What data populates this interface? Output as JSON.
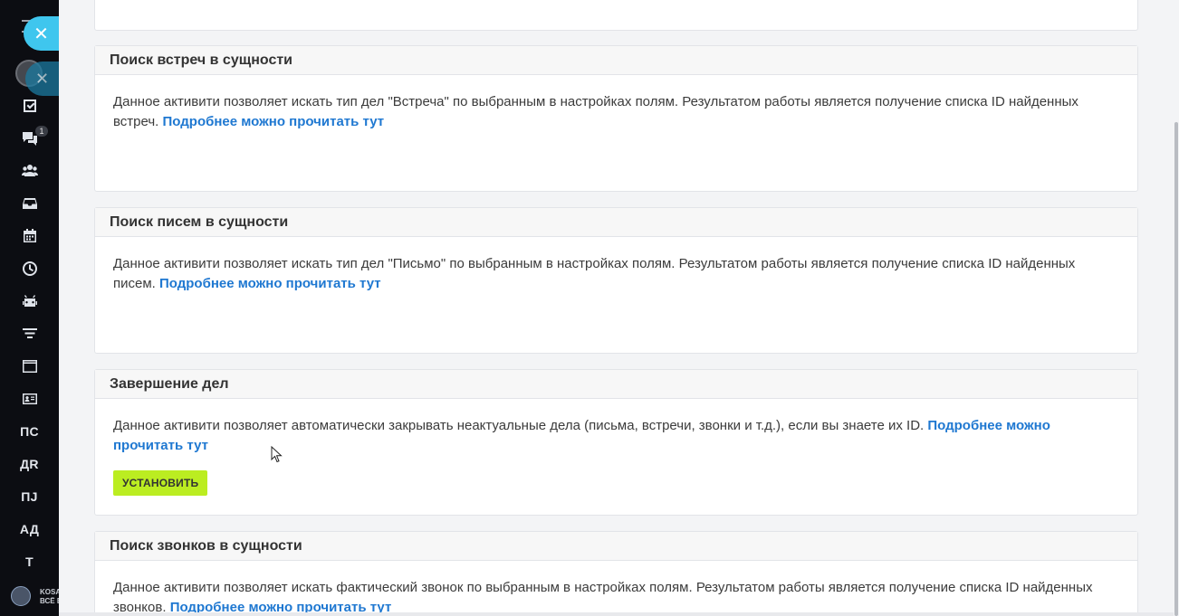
{
  "sidebar": {
    "close_glyph": "✕",
    "badge_count": "1",
    "text_items": [
      "ПС",
      "ДR",
      "ПJ",
      "АД",
      "Т"
    ],
    "company_line1": "KOSA",
    "company_line2": "ВСЁ Б",
    "icons": [
      "checkbox-icon",
      "chat-icon",
      "users-icon",
      "inbox-icon",
      "calendar-icon",
      "clock-icon",
      "robot-icon",
      "funnel-icon",
      "window-icon",
      "contact-card-icon"
    ]
  },
  "cards": [
    {
      "title": "Поиск встреч в сущности",
      "text": "Данное активити позволяет искать тип дел \"Встреча\" по выбранным в настройках полям. Результатом работы является получение списка ID найденных встреч.",
      "link": "Подробнее можно прочитать тут"
    },
    {
      "title": "Поиск писем в сущности",
      "text": "Данное активити позволяет искать тип дел \"Письмо\" по выбранным в настройках полям. Результатом работы является получение списка ID найденных писем.",
      "link": "Подробнее можно прочитать тут"
    },
    {
      "title": "Завершение дел",
      "text": "Данное активити позволяет автоматически закрывать неактуальные дела (письма, встречи, звонки и т.д.), если вы знаете их ID.",
      "link": "Подробнее можно прочитать тут",
      "button": "УСТАНОВИТЬ"
    },
    {
      "title": "Поиск звонков в сущности",
      "text": "Данное активити позволяет искать фактический звонок по выбранным в настройках полям. Результатом работы является получение списка ID найденных звонков.",
      "link": "Подробнее можно прочитать тут"
    }
  ],
  "colors": {
    "sidebar_bg": "#0c0d12",
    "accent_close": "#3fc6ee",
    "link": "#1f78d1",
    "install_button": "#bbed21"
  }
}
